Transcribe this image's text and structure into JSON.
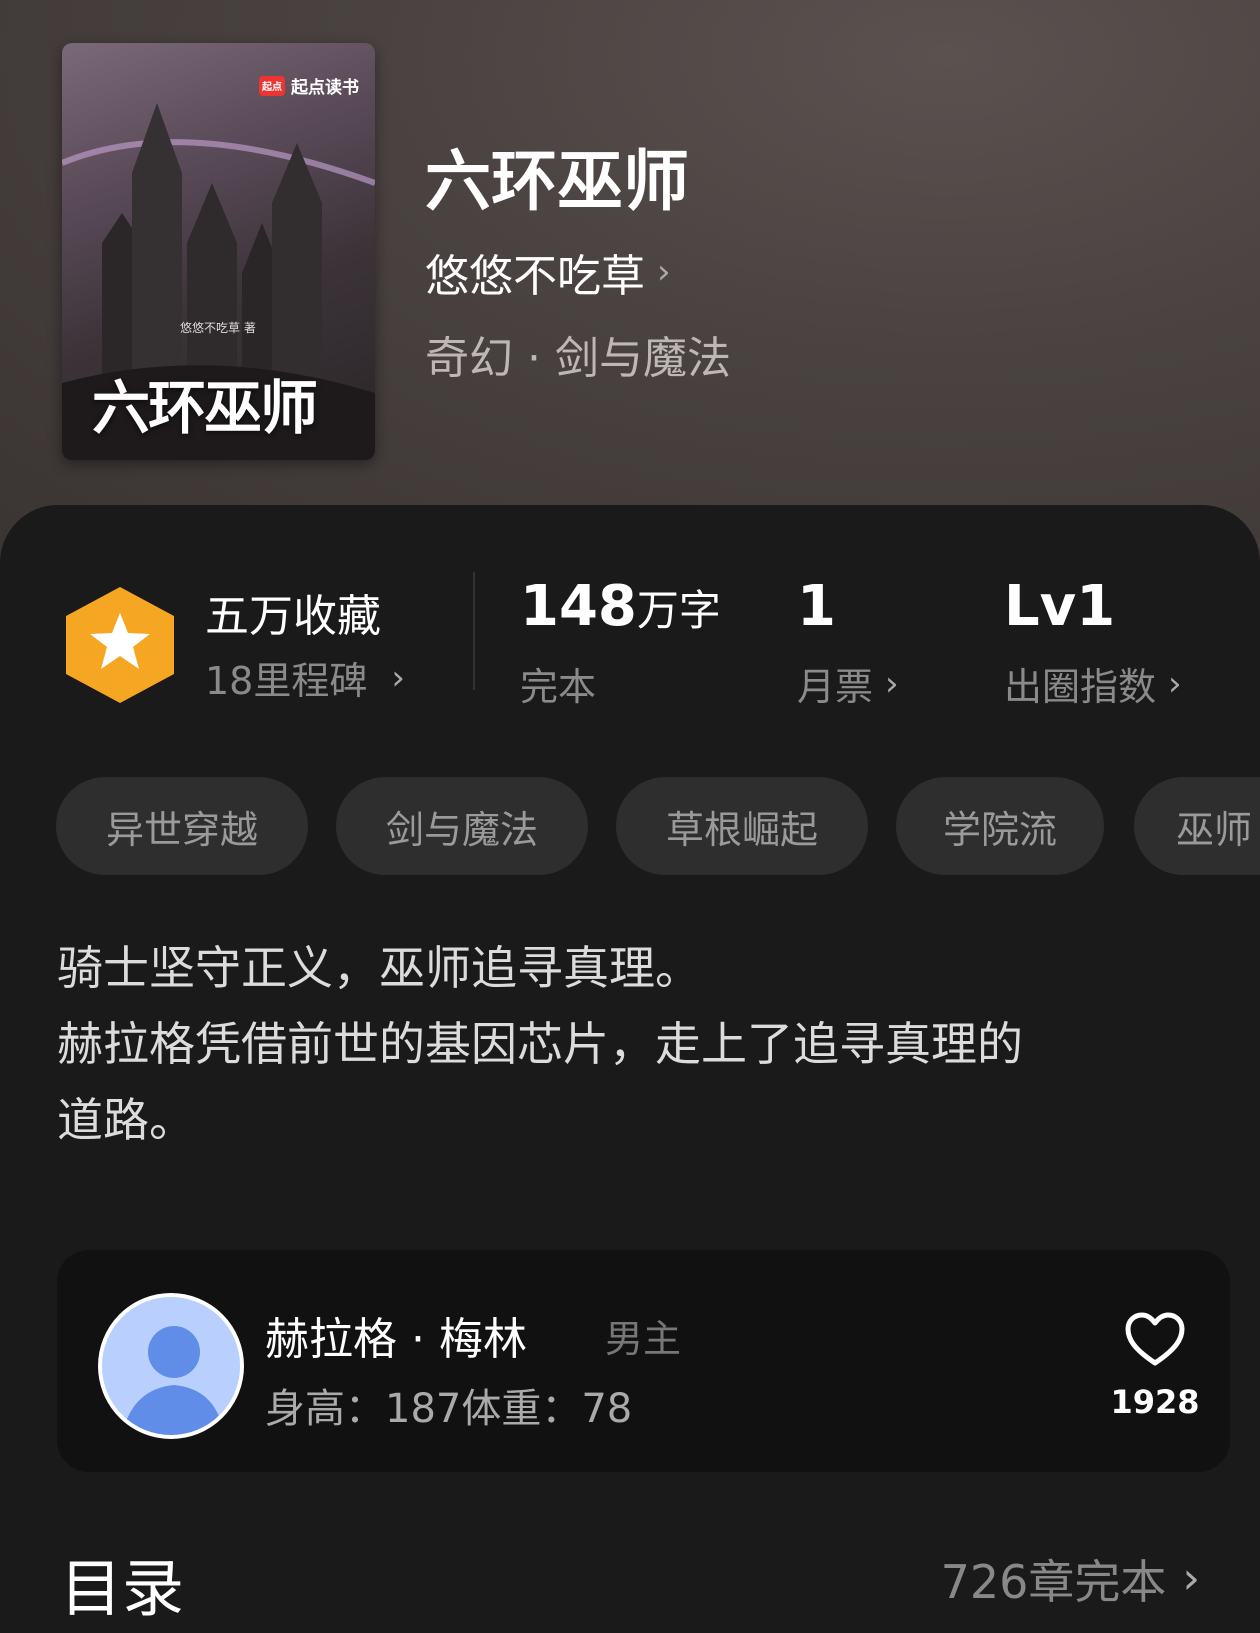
{
  "cover": {
    "brand": "起点读书",
    "brand_logo": "起点",
    "author_line": "悠悠不吃草 著",
    "title": "六环巫师"
  },
  "book": {
    "title": "六环巫师",
    "author": "悠悠不吃草",
    "genre": "奇幻 · 剑与魔法"
  },
  "stats": {
    "favorites": {
      "main": "五万收藏",
      "sub": "18里程碑"
    },
    "words": {
      "number": "148",
      "unit": "万字",
      "label": "完本"
    },
    "monthly_ticket": {
      "number": "1",
      "label": "月票"
    },
    "index": {
      "number": "Lv1",
      "label": "出圈指数"
    }
  },
  "tags": [
    "异世穿越",
    "剑与魔法",
    "草根崛起",
    "学院流",
    "巫师"
  ],
  "intro": [
    "骑士坚守正义，巫师追寻真理。",
    "赫拉格凭借前世的基因芯片，走上了追寻真理的",
    "道路。"
  ],
  "character": {
    "name": "赫拉格 · 梅林",
    "role": "男主",
    "info": "身高：187体重：78",
    "likes": "1928"
  },
  "toc": {
    "title": "目录",
    "count": "726章完本"
  },
  "colors": {
    "background": "#1a1a1a",
    "badge": "#f5a623",
    "tag_bg": "#2e2e2e"
  }
}
